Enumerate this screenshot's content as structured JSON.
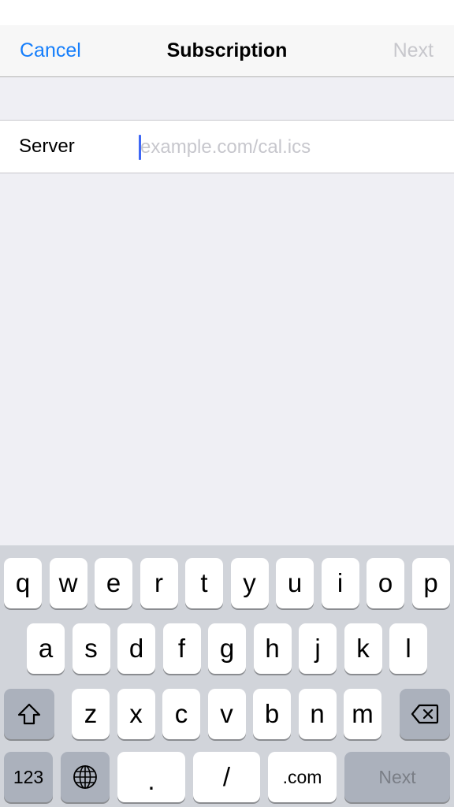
{
  "navbar": {
    "cancel_label": "Cancel",
    "title": "Subscription",
    "next_label": "Next"
  },
  "form": {
    "server_label": "Server",
    "server_value": "",
    "server_placeholder": "example.com/cal.ics"
  },
  "keyboard": {
    "row1": [
      "q",
      "w",
      "e",
      "r",
      "t",
      "y",
      "u",
      "i",
      "o",
      "p"
    ],
    "row2": [
      "a",
      "s",
      "d",
      "f",
      "g",
      "h",
      "j",
      "k",
      "l"
    ],
    "row3": [
      "z",
      "x",
      "c",
      "v",
      "b",
      "n",
      "m"
    ],
    "shift_icon": "shift-icon",
    "delete_icon": "delete-icon",
    "numbers_label": "123",
    "globe_icon": "globe-icon",
    "dot_label": ".",
    "slash_label": "/",
    "dotcom_label": ".com",
    "return_label": "Next"
  },
  "colors": {
    "accent": "#157efb",
    "disabled": "#c7c7cc",
    "caret": "#3e67f5",
    "keyboard_bg": "#d1d4da"
  }
}
